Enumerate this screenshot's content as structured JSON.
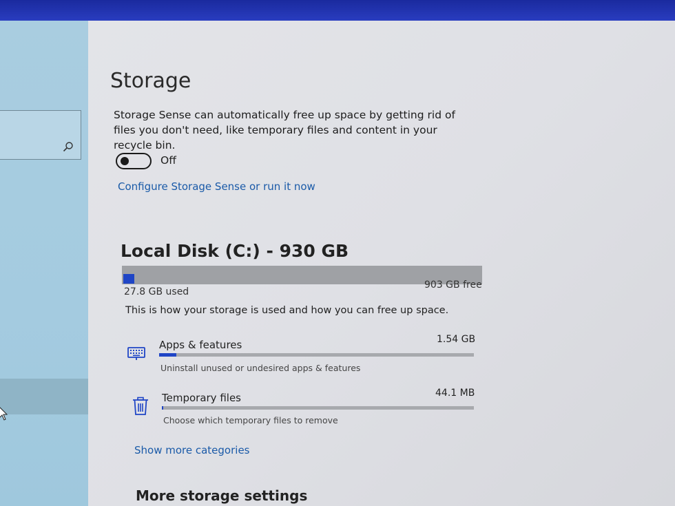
{
  "page": {
    "title": "Storage"
  },
  "storage_sense": {
    "description": "Storage Sense can automatically free up space by getting rid of files you don't need, like temporary files and content in your recycle bin.",
    "toggle_state": "Off",
    "configure_link": "Configure Storage Sense or run it now"
  },
  "disk": {
    "title": "Local Disk (C:) - 930 GB",
    "used": "27.8 GB used",
    "free": "903 GB free",
    "used_fraction": 0.03
  },
  "usage": {
    "description": "This is how your storage is used and how you can free up space.",
    "categories": [
      {
        "name": "Apps & features",
        "size": "1.54 GB",
        "subtitle": "Uninstall unused or undesired apps & features",
        "icon": "keyboard-icon",
        "fraction": 0.055
      },
      {
        "name": "Temporary files",
        "size": "44.1 MB",
        "subtitle": "Choose which temporary files to remove",
        "icon": "trash-icon",
        "fraction": 0.004
      }
    ]
  },
  "show_more_link": "Show more categories",
  "more_settings_heading": "More storage settings",
  "colors": {
    "accent": "#1f45c6",
    "link": "#1a5aa8",
    "sidebar": "#a4cbe0"
  }
}
